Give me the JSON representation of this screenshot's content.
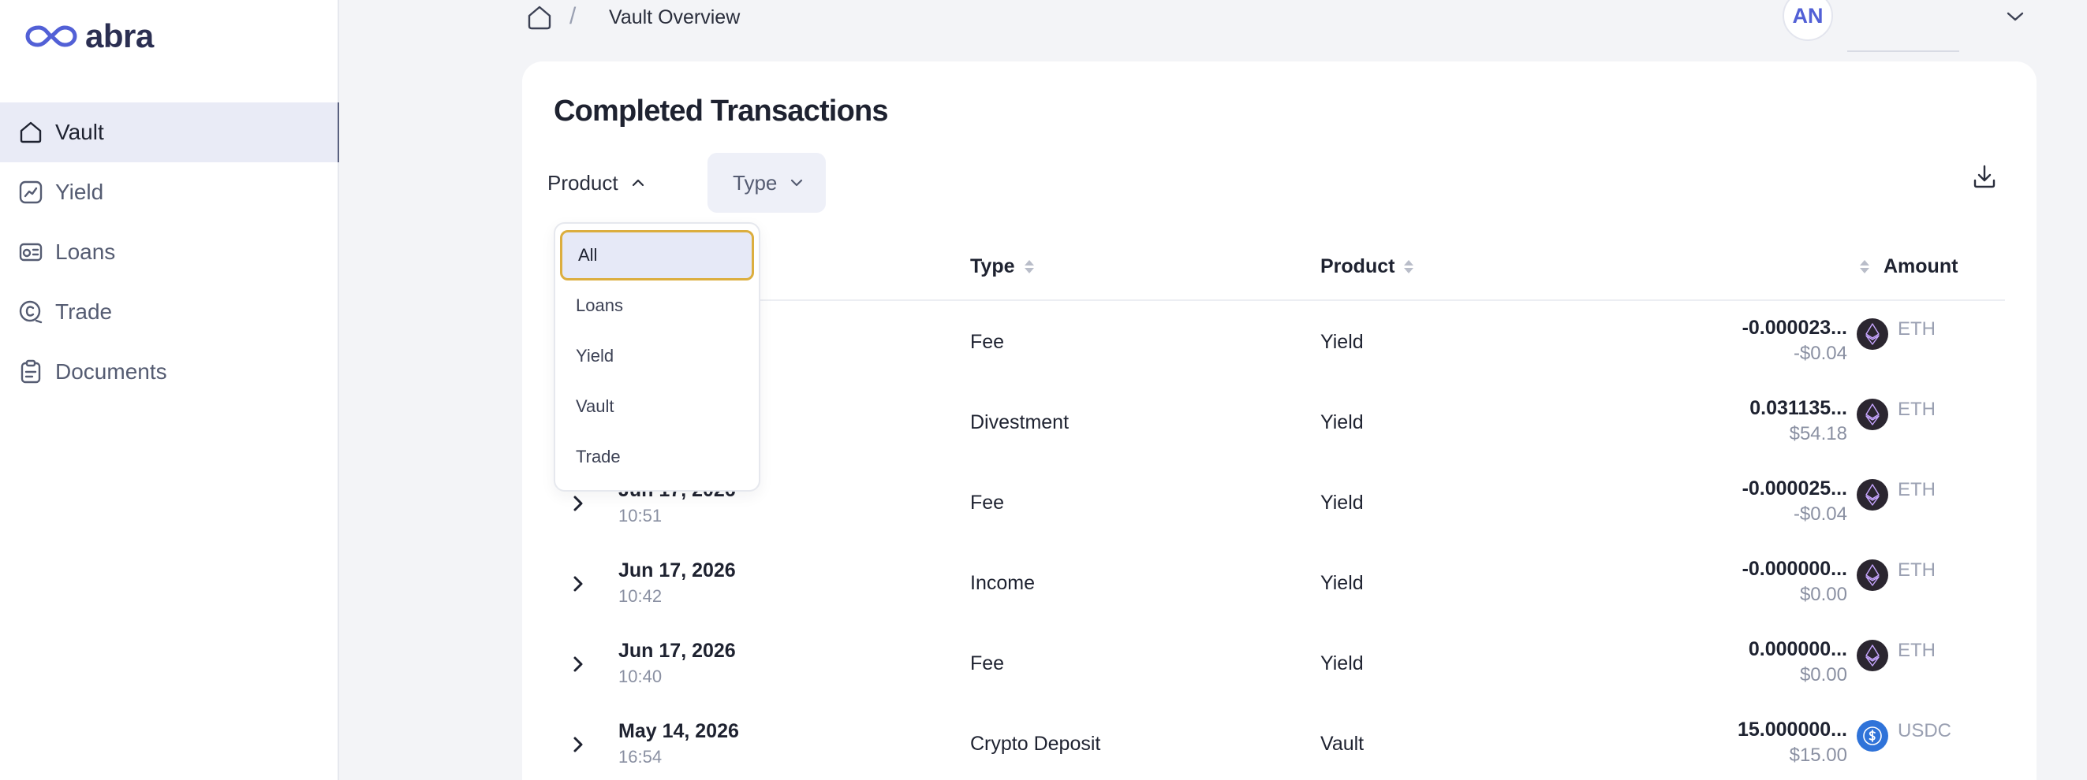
{
  "app": {
    "logo_text": "abra"
  },
  "sidebar": {
    "items": [
      {
        "label": "Vault",
        "icon": "home-icon",
        "active": true
      },
      {
        "label": "Yield",
        "icon": "chart-up-icon",
        "active": false
      },
      {
        "label": "Loans",
        "icon": "loans-icon",
        "active": false
      },
      {
        "label": "Trade",
        "icon": "trade-coin-icon",
        "active": false
      },
      {
        "label": "Documents",
        "icon": "clipboard-icon",
        "active": false
      }
    ]
  },
  "header": {
    "breadcrumb_separator": "/",
    "breadcrumb": "Vault Overview",
    "avatar_initials": "AN"
  },
  "main": {
    "title": "Completed Transactions",
    "filters": {
      "product_label": "Product",
      "type_label": "Type"
    },
    "table": {
      "columns": {
        "type": "Type",
        "product": "Product",
        "amount": "Amount"
      },
      "rows": [
        {
          "date": "",
          "time": "",
          "type": "Fee",
          "product": "Yield",
          "amount": "-0.000023...",
          "fiat": "-$0.04",
          "asset": "ETH"
        },
        {
          "date": "",
          "time": "",
          "type": "Divestment",
          "product": "Yield",
          "amount": "0.031135...",
          "fiat": "$54.18",
          "asset": "ETH"
        },
        {
          "date": "Jun 17, 2026",
          "time": "10:51",
          "type": "Fee",
          "product": "Yield",
          "amount": "-0.000025...",
          "fiat": "-$0.04",
          "asset": "ETH"
        },
        {
          "date": "Jun 17, 2026",
          "time": "10:42",
          "type": "Income",
          "product": "Yield",
          "amount": "-0.000000...",
          "fiat": "$0.00",
          "asset": "ETH"
        },
        {
          "date": "Jun 17, 2026",
          "time": "10:40",
          "type": "Fee",
          "product": "Yield",
          "amount": "0.000000...",
          "fiat": "$0.00",
          "asset": "ETH"
        },
        {
          "date": "May 14, 2026",
          "time": "16:54",
          "type": "Crypto Deposit",
          "product": "Vault",
          "amount": "15.000000...",
          "fiat": "$15.00",
          "asset": "USDC"
        }
      ]
    }
  },
  "product_dropdown": {
    "open": true,
    "options": [
      "All",
      "Loans",
      "Yield",
      "Vault",
      "Trade"
    ],
    "selected": "All"
  },
  "colors": {
    "accent": "#5260d6",
    "selected_outline": "#dcae3e",
    "eth_coin": "#2b2630",
    "usdc_coin": "#2f73d9"
  }
}
